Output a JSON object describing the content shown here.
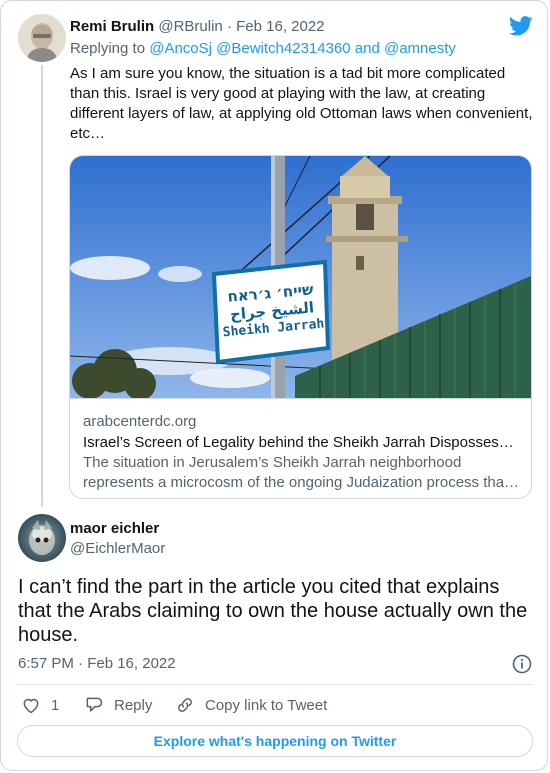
{
  "reply_tweet": {
    "author_name": "Remi Brulin",
    "author_handle": "@RBrulin",
    "date": "· Feb 16, 2022",
    "replying_prefix": "Replying to ",
    "replying_handles": "@AncoSj @Bewitch42314360 and @amnesty",
    "text_lines": [
      "As I am sure you know, the situation is a tad bit more complicated",
      "than this. Israel is very good at playing with the law, at creating",
      "different layers of law, at applying old Ottoman laws when convenient,",
      "etc…"
    ],
    "link_card": {
      "domain": "arabcenterdc.org",
      "title": "Israel’s Screen of Legality behind the Sheikh Jarrah Disposses…",
      "description_lines": [
        "The situation in Jerusalem’s Sheikh Jarrah neighborhood",
        "represents a microcosm of the ongoing Judaization process tha…"
      ],
      "sign_hebrew": "שייח׳ ג׳ראח",
      "sign_arabic": "الشيخ جراح",
      "sign_latin": "Sheikh Jarrah"
    }
  },
  "main_tweet": {
    "author_name": "maor eichler",
    "author_handle": "@EichlerMaor",
    "text_lines": [
      "I can’t find the part in the article you cited that explains",
      "that the Arabs claiming to own the house actually own the",
      "house."
    ],
    "timestamp": "6:57 PM · Feb 16, 2022",
    "actions": {
      "like_count": "1",
      "reply_label": "Reply",
      "copy_label": "Copy link to Tweet"
    },
    "explore_label": "Explore what's happening on Twitter"
  },
  "icons": {
    "brand": "twitter-bird-icon",
    "info": "info-icon",
    "like": "heart-icon",
    "reply": "speech-bubble-icon",
    "copy": "link-icon"
  },
  "colors": {
    "accent": "#1d9bf0",
    "muted": "#536471",
    "border": "#cfd9de"
  }
}
